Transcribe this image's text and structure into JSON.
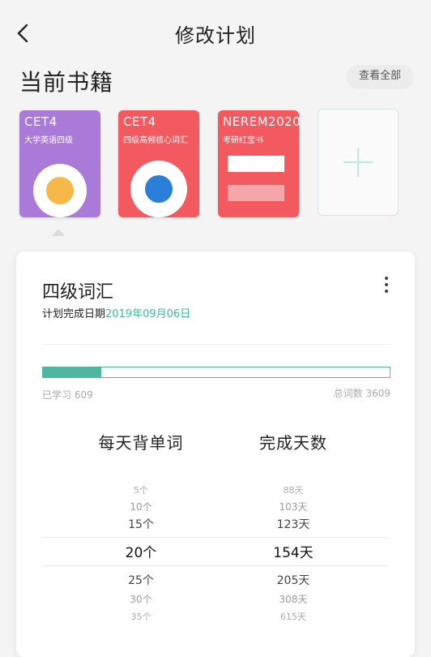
{
  "header": {
    "title": "修改计划",
    "back_icon": "chevron-left-icon"
  },
  "section": {
    "title": "当前书籍",
    "view_all_label": "查看全部"
  },
  "books": [
    {
      "code": "CET4",
      "name": "大学英语四级",
      "color": "#a97ad8",
      "accent": "#f7b84a"
    },
    {
      "code": "CET4",
      "name": "四级高频核心词汇",
      "color": "#f25a5f",
      "accent": "#2c7fd9"
    },
    {
      "code": "NEREM2020",
      "name": "考研红宝书",
      "color": "#f25a5f",
      "accent": "#ffffff"
    }
  ],
  "add_book": {
    "icon": "plus-icon",
    "color": "#bfe8df"
  },
  "plan": {
    "name": "四级词汇",
    "date_label": "计划完成日期",
    "date_value": "2019年09月06日",
    "learned_label": "已学习 609",
    "total_label": "总词数 3609",
    "progress_fraction": 0.169,
    "more_icon": "more-vertical-icon",
    "accent": "#4fb79f"
  },
  "picker": {
    "daily_label": "每天背单词",
    "days_label": "完成天数",
    "daily_options": [
      "5个",
      "10个",
      "15个",
      "20个",
      "25个",
      "30个",
      "35个"
    ],
    "days_options": [
      "88天",
      "103天",
      "123天",
      "154天",
      "205天",
      "308天",
      "615天"
    ],
    "selected_index": 3
  }
}
